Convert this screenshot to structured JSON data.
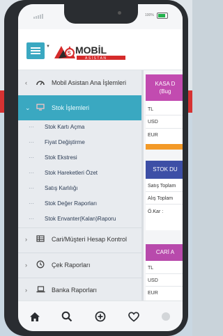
{
  "status_bar": {
    "battery_percent": "100%",
    "battery_level": 0.9
  },
  "header": {
    "logo_text": "MOBİL",
    "logo_subtext": "ASİSTAN"
  },
  "sidebar": {
    "items": [
      {
        "label": "Mobil Asistan Ana İşlemleri",
        "icon": "dashboard-icon"
      },
      {
        "label": "Stok İşlemleri",
        "icon": "monitor-icon",
        "active": true
      },
      {
        "label": "Cari/Müşteri Hesap Kontrol",
        "icon": "table-icon"
      },
      {
        "label": "Çek Raporları",
        "icon": "clock-icon"
      },
      {
        "label": "Banka Raporları",
        "icon": "laptop-icon"
      }
    ],
    "submenu": [
      {
        "label": "Stok Kartı Açma"
      },
      {
        "label": "Fiyat Değiştirme"
      },
      {
        "label": "Stok Ekstresi"
      },
      {
        "label": "Stok Hareketleri Özet"
      },
      {
        "label": "Satış Karlılığı"
      },
      {
        "label": "Stok Değer Raporları"
      },
      {
        "label": "Stok Envanter(Kalan)Raporu"
      }
    ]
  },
  "cards": [
    {
      "title": "KASA D",
      "subtitle": "(Bug",
      "rows": [
        "TL",
        "USD",
        "EUR"
      ],
      "color": "#c24bb0"
    },
    {
      "title": "STOK DU",
      "rows": [
        "Satış Toplam",
        "Alış Toplam",
        "Ö.Kar :"
      ],
      "color": "#3d4fa6"
    },
    {
      "title": "CARİ A",
      "rows": [
        "TL",
        "USD",
        "EUR"
      ],
      "color": "#b84aac"
    }
  ],
  "colors": {
    "accent": "#3aa8c1",
    "orange_bar": "#f39a28",
    "brand_red": "#d52b2b"
  },
  "bottom_nav": [
    {
      "icon": "home-icon"
    },
    {
      "icon": "search-icon"
    },
    {
      "icon": "plus-circle-icon"
    },
    {
      "icon": "heart-icon"
    },
    {
      "icon": "profile-icon"
    }
  ]
}
